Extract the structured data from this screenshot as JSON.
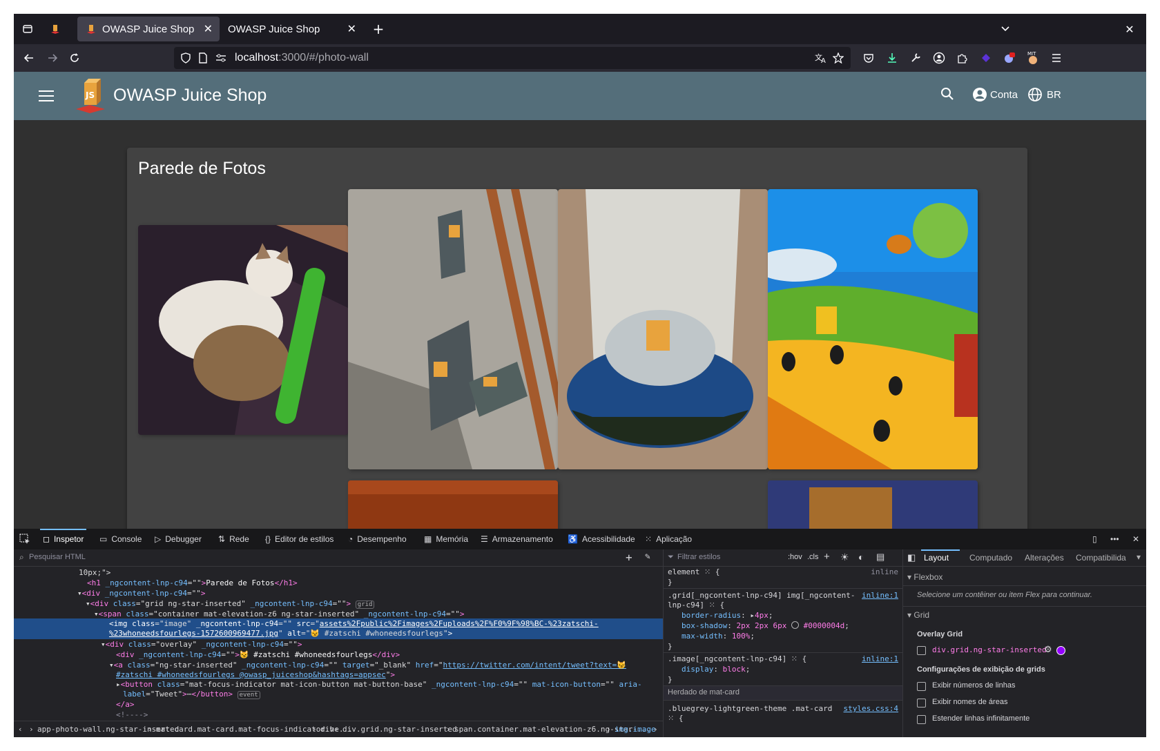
{
  "browser": {
    "tabs": [
      {
        "label": "OWASP Juice Shop",
        "active": true
      },
      {
        "label": "OWASP Juice Shop",
        "active": false
      }
    ],
    "url_host": "localhost",
    "url_path": ":3000/#/photo-wall",
    "extension_badge": "MIT"
  },
  "app": {
    "title": "OWASP Juice Shop",
    "account_label": "Conta",
    "language_label": "BR",
    "page_title": "Parede de Fotos"
  },
  "devtools": {
    "tabs": [
      "Inspetor",
      "Console",
      "Debugger",
      "Rede",
      "Editor de estilos",
      "Desempenho",
      "Memória",
      "Armazenamento",
      "Acessibilidade",
      "Aplicação"
    ],
    "search_placeholder": "Pesquisar HTML",
    "html": {
      "l1": "10px;\">",
      "l2_text": "Parede de Fotos",
      "img_src": "assets%2Fpublic%2Fimages%2Fuploads%2F%F0%9F%98%BC-%23zatschi-",
      "img_src2": "%23whoneedsfourlegs-1572600969477.jpg",
      "img_alt": "😼 #zatschi #whoneedsfourlegs",
      "div_text": "😼 #zatschi #whoneedsfourlegs",
      "href": "https://twitter.com/intent/tweet?text=😼",
      "href2": "#zatschi #whoneedsfourlegs @owasp_juiceshop&hashtags=appsec",
      "badge_grid": "grid",
      "badge_event": "event"
    },
    "breadcrumbs": [
      "app-photo-wall.ng-star-inserted",
      "mat-card.mat-card.mat-focus-indicator.he...",
      "div",
      "div.grid.ng-star-inserted",
      "span.container.mat-elevation-z6.ng-star-...",
      "img.image"
    ],
    "rules": {
      "filter_placeholder": "Filtrar estilos",
      "hov": ":hov",
      "cls": ".cls",
      "element": "element",
      "inline": "inline",
      "sel1": ".grid[_ngcontent-lnp-c94] img[_ngcontent-",
      "sel1b": "lnp-c94]",
      "src1": "inline:1",
      "border_radius": "4px",
      "box_shadow": "2px 2px 6px",
      "box_shadow_color": "#0000004d",
      "max_width": "100%",
      "sel2": ".image[_ngcontent-lnp-c94]",
      "src2": "inline:1",
      "display": "block",
      "inherited": "Herdado de mat-card",
      "sel3": ".bluegrey-lightgreen-theme .mat-card",
      "src3": "styles.css:4"
    },
    "layout": {
      "tabs": [
        "Layout",
        "Computado",
        "Alterações",
        "Compatibilida"
      ],
      "flexbox": "Flexbox",
      "flex_hint": "Selecione um contêiner ou item Flex para continuar.",
      "grid": "Grid",
      "overlay_grid": "Overlay Grid",
      "grid_item": "div.grid.ng-star-inserted",
      "grid_opts_title": "Configurações de exibição de grids",
      "opts": [
        "Exibir números de linhas",
        "Exibir nomes de áreas",
        "Estender linhas infinitamente"
      ]
    }
  }
}
